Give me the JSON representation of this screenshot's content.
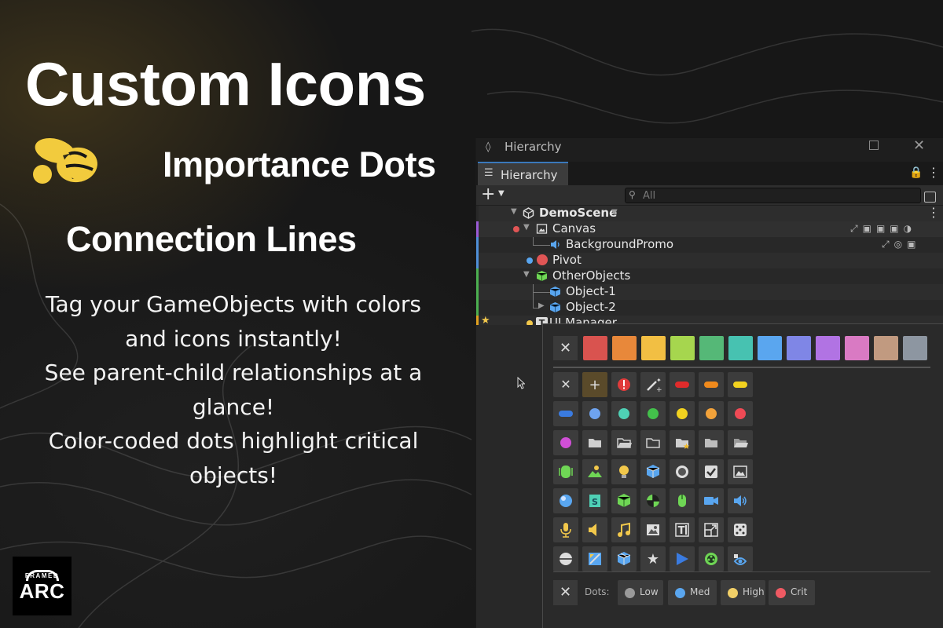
{
  "promo": {
    "title": "Custom Icons",
    "feature_1": "Importance Dots",
    "feature_2": "Connection Lines",
    "description": [
      "Tag your GameObjects with colors",
      "and icons instantly!",
      "See parent-child relationships at a",
      "glance!",
      "Color-coded dots highlight critical",
      "objects!"
    ],
    "logo_top": "FRAMED",
    "logo_main": "ARC"
  },
  "window": {
    "title": "Hierarchy",
    "tab_label": "Hierarchy",
    "search_placeholder": "All"
  },
  "hierarchy": {
    "rows": [
      {
        "label": "DemoScene",
        "stripe": "",
        "dot": ""
      },
      {
        "label": "Canvas",
        "stripe": "#9a5bd6",
        "dot": "#e05555"
      },
      {
        "label": "BackgroundPromo",
        "stripe": "#4f8fd8",
        "dot": ""
      },
      {
        "label": "Pivot",
        "stripe": "#4f8fd8",
        "dot": "#59a6f0"
      },
      {
        "label": "OtherObjects",
        "stripe": "#4caf50",
        "dot": ""
      },
      {
        "label": "Object-1",
        "stripe": "#4caf50",
        "dot": ""
      },
      {
        "label": "Object-2",
        "stripe": "#4caf50",
        "dot": ""
      },
      {
        "label": "UI Manager",
        "stripe": "#e0a020",
        "dot": "#f2c84b"
      }
    ]
  },
  "palette": {
    "colors": [
      "#d9534f",
      "#e8883a",
      "#f2bf43",
      "#a6d64e",
      "#55b877",
      "#47c2b1",
      "#5aa6ef",
      "#7f86e6",
      "#b173e3",
      "#d97ac3",
      "#c19a80",
      "#8d96a1"
    ],
    "icons": [
      "clear-icon",
      "plus-icon",
      "error-icon",
      "magic-wand-icon",
      "red-pill-icon",
      "orange-pill-icon",
      "yellow-pill-icon",
      "blue-pill-icon",
      "blue-dot-icon",
      "teal-dot-icon",
      "green-dot-icon",
      "yellow-dot-icon",
      "orange-dot-icon",
      "red-dot-icon",
      "magenta-dot-icon",
      "folder-icon",
      "folder-open-icon",
      "folder-outline-icon",
      "folder-star-icon",
      "folder-filled-icon",
      "folder-open-alt-icon",
      "audio-source-icon",
      "terrain-icon",
      "light-icon",
      "prefab-icon",
      "record-icon",
      "checkbox-icon",
      "image-frame-icon",
      "sphere-icon",
      "script-icon",
      "cube-icon",
      "material-icon",
      "mouse-icon",
      "camera-icon",
      "speaker-icon",
      "microphone-icon",
      "sound-icon",
      "music-icon",
      "picture-icon",
      "text-icon",
      "scale-icon",
      "dice-icon",
      "globe-icon",
      "rect-transform-icon",
      "package-icon",
      "star-icon",
      "play-icon",
      "particle-icon",
      "visibility-icon"
    ],
    "dots_label": "Dots:",
    "dots": [
      {
        "label": "Low",
        "color": "#9a9a9a"
      },
      {
        "label": "Med",
        "color": "#5aa6ef"
      },
      {
        "label": "High",
        "color": "#f2d068"
      },
      {
        "label": "Crit",
        "color": "#ef5a63"
      }
    ]
  }
}
